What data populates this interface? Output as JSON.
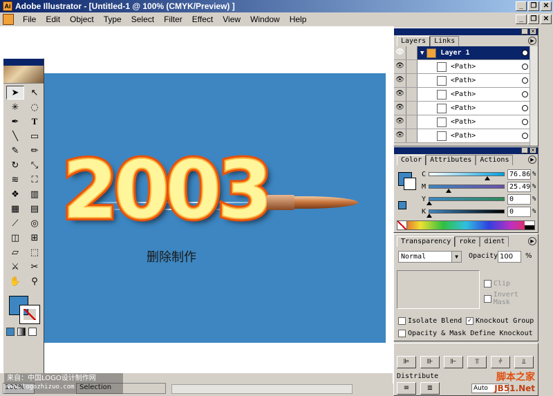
{
  "window": {
    "title": "Adobe Illustrator - [Untitled-1 @ 100% (CMYK/Preview) ]",
    "controls": [
      "_",
      "❐",
      "✕"
    ]
  },
  "menu": {
    "items": [
      "File",
      "Edit",
      "Object",
      "Type",
      "Select",
      "Filter",
      "Effect",
      "View",
      "Window",
      "Help"
    ]
  },
  "canvas": {
    "artwork_text": "2003",
    "caption": "删除制作",
    "artboard_color": "#3d86c1"
  },
  "toolbox": {
    "fill_color": "#3d86c1"
  },
  "statusbar": {
    "zoom": "100%",
    "status_label": "Selection",
    "watermark_line1": "来自：中国LOGO设计制作网",
    "watermark_line2": "www.logozhizuo.com"
  },
  "layers_panel": {
    "tabs": [
      "Layers",
      "Links"
    ],
    "layer_name": "Layer 1",
    "paths": [
      "<Path>",
      "<Path>",
      "<Path>",
      "<Path>",
      "<Path>",
      "<Path>"
    ]
  },
  "color_panel": {
    "tabs": [
      "Color",
      "Attributes",
      "Actions"
    ],
    "channels": [
      {
        "label": "C",
        "value": "76.86"
      },
      {
        "label": "M",
        "value": "25.49"
      },
      {
        "label": "Y",
        "value": "0"
      },
      {
        "label": "K",
        "value": "0"
      }
    ],
    "percent": "%"
  },
  "transparency_panel": {
    "tabs": [
      "Transparency",
      "roke",
      "dient"
    ],
    "blend_mode": "Normal",
    "opacity_label": "Opacity",
    "opacity_value": "100",
    "percent": "%",
    "clip_label": "Clip",
    "invert_mask_label": "Invert Mask",
    "isolate_blending_label": "Isolate Blend",
    "knockout_group_label": "Knockout Group",
    "opacity_mask_label": "Opacity & Mask Define Knockout"
  },
  "align_panel": {
    "distribute_label": "Distribute",
    "spacing_value": "Auto"
  },
  "watermark_right": {
    "line1": "脚本之家",
    "line2": "JB51.Net"
  }
}
